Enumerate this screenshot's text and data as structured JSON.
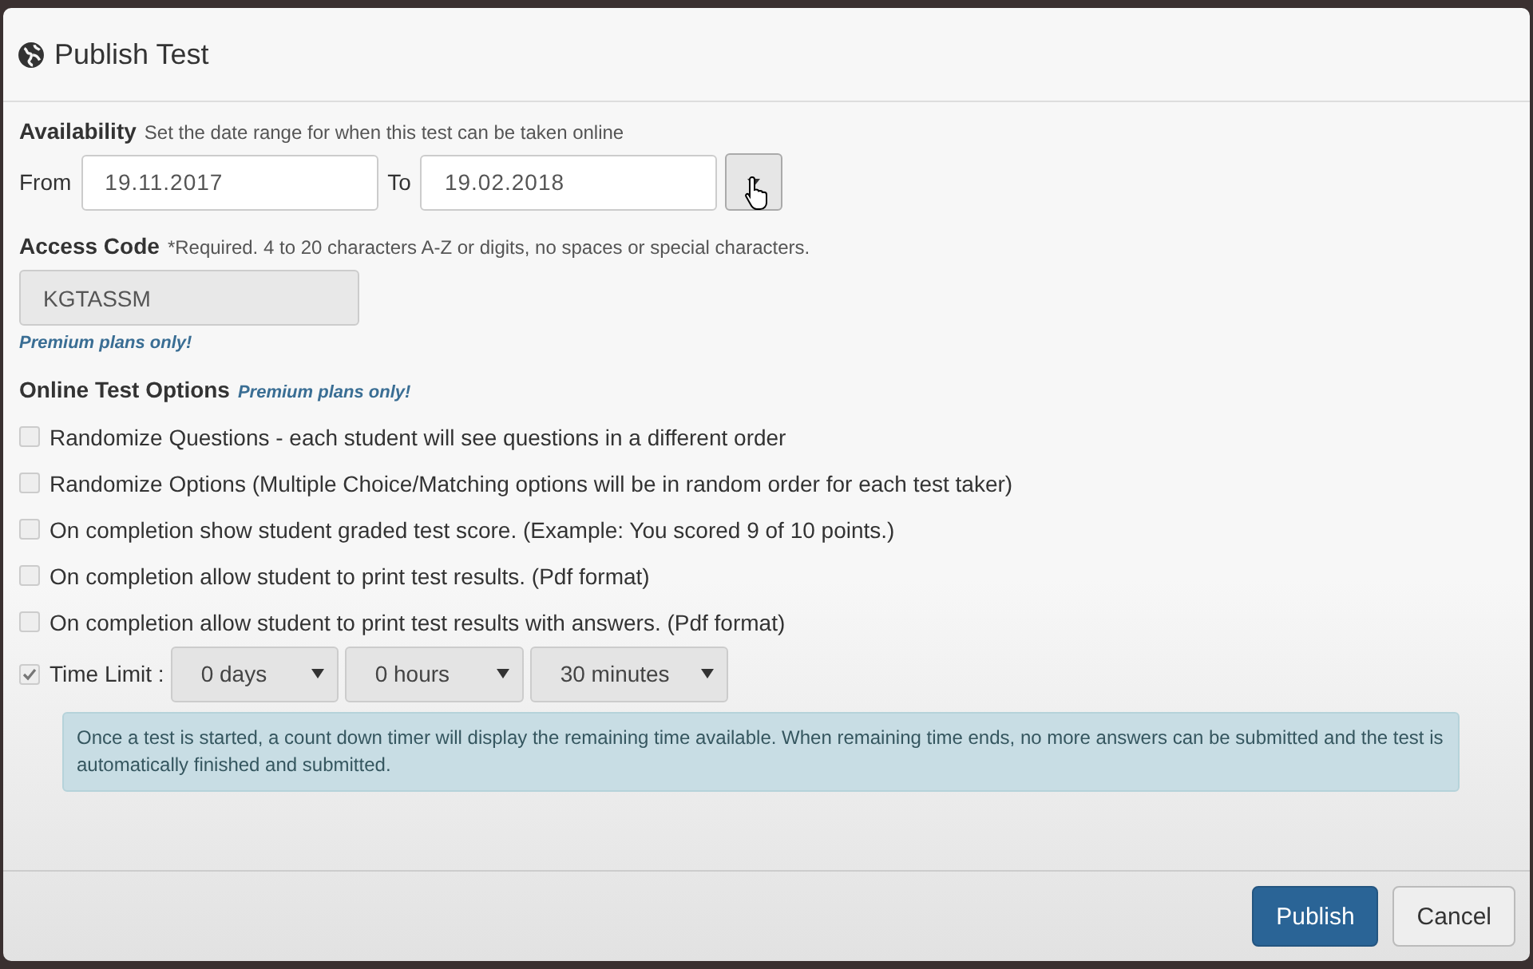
{
  "dialog": {
    "title": "Publish Test"
  },
  "availability": {
    "label": "Availability",
    "hint": "Set the date range for when this test can be taken online",
    "from_label": "From",
    "from_value": "19.11.2017",
    "to_label": "To",
    "to_value": "19.02.2018"
  },
  "access_code": {
    "label": "Access Code",
    "hint": "*Required. 4 to 20 characters A-Z or digits, no spaces or special characters.",
    "value": "KGTASSM",
    "disabled": true,
    "note": "Premium plans only!"
  },
  "options": {
    "label": "Online Test Options",
    "note": "Premium plans only!",
    "items": [
      {
        "label": "Randomize Questions - each student will see questions in a different order",
        "checked": false
      },
      {
        "label": "Randomize Options (Multiple Choice/Matching options will be in random order for each test taker)",
        "checked": false
      },
      {
        "label": "On completion show student graded test score. (Example: You scored 9 of 10 points.)",
        "checked": false
      },
      {
        "label": "On completion allow student to print test results. (Pdf format)",
        "checked": false
      },
      {
        "label": "On completion allow student to print test results with answers. (Pdf format)",
        "checked": false
      }
    ]
  },
  "time_limit": {
    "label": "Time Limit :",
    "checked": true,
    "selects": [
      "0 days",
      "0 hours",
      "30 minutes"
    ],
    "info": "Once a test is started, a count down timer will display the remaining time available. When remaining time ends, no more answers can be submitted and the test is automatically finished and submitted."
  },
  "buttons": [
    {
      "label": "Publish",
      "kind": "primary"
    },
    {
      "label": "Cancel",
      "kind": "default"
    }
  ]
}
